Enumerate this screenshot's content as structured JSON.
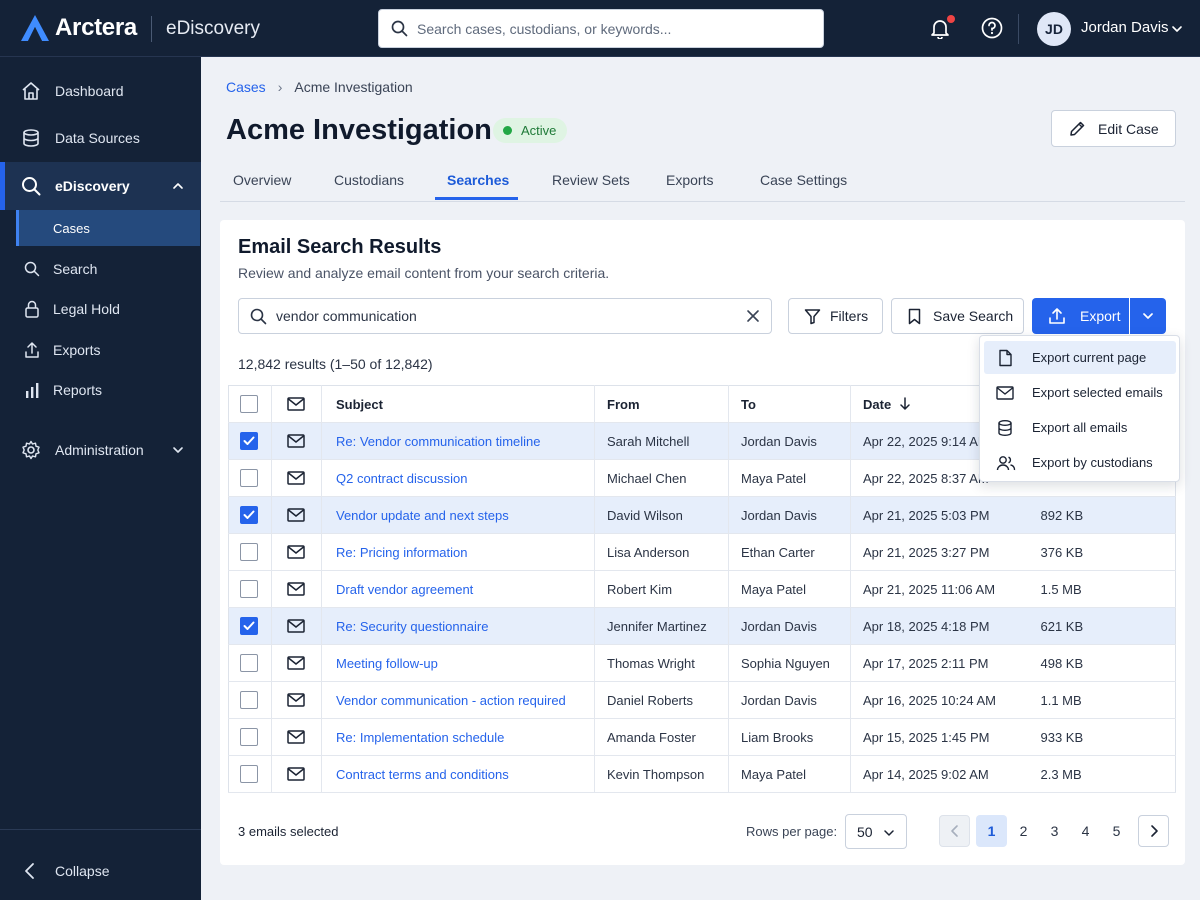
{
  "app": {
    "brand": "Arctera",
    "product": "eDiscovery",
    "search_placeholder": "Search cases, custodians, or keywords...",
    "user": {
      "initials": "JD",
      "name": "Jordan Davis"
    },
    "accent": "#2563eb"
  },
  "sidebar": {
    "items": [
      {
        "label": "Dashboard",
        "icon": "home-icon"
      },
      {
        "label": "Data Sources",
        "icon": "database-icon"
      },
      {
        "label": "eDiscovery",
        "icon": "search-icon"
      },
      {
        "label": "Cases"
      },
      {
        "label": "Search",
        "icon": "search-icon"
      },
      {
        "label": "Legal Hold",
        "icon": "lock-icon"
      },
      {
        "label": "Exports",
        "icon": "upload-icon"
      },
      {
        "label": "Reports",
        "icon": "bar-chart-icon"
      },
      {
        "label": "Administration",
        "icon": "gear-icon"
      }
    ],
    "collapse": "Collapse"
  },
  "breadcrumb": {
    "root": "Cases",
    "current": "Acme Investigation"
  },
  "case": {
    "title": "Acme Investigation",
    "status": "Active",
    "edit_label": "Edit Case"
  },
  "tabs": [
    "Overview",
    "Custodians",
    "Searches",
    "Review Sets",
    "Exports",
    "Case Settings"
  ],
  "active_tab": "Searches",
  "results": {
    "title": "Email Search Results",
    "subtitle": "Review and analyze email content from your search criteria.",
    "query": "vendor communication",
    "filters_label": "Filters",
    "save_label": "Save Search",
    "export_label": "Export",
    "count_text": "12,842 results (1–50 of 12,842)",
    "columns": {
      "subject": "Subject",
      "from": "From",
      "to": "To",
      "date": "Date"
    },
    "rows": [
      {
        "checked": true,
        "subject": "Re: Vendor communication timeline",
        "from": "Sarah Mitchell",
        "to": "Jordan Davis",
        "date": "Apr 22, 2025 9:14 AM",
        "size": ""
      },
      {
        "checked": false,
        "subject": "Q2 contract discussion",
        "from": "Michael Chen",
        "to": "Maya Patel",
        "date": "Apr 22, 2025 8:37 AM",
        "size": ""
      },
      {
        "checked": true,
        "subject": "Vendor update and next steps",
        "from": "David Wilson",
        "to": "Jordan Davis",
        "date": "Apr 21, 2025 5:03 PM",
        "size": "892 KB"
      },
      {
        "checked": false,
        "subject": "Re: Pricing information",
        "from": "Lisa Anderson",
        "to": "Ethan Carter",
        "date": "Apr 21, 2025 3:27 PM",
        "size": "376 KB"
      },
      {
        "checked": false,
        "subject": "Draft vendor agreement",
        "from": "Robert Kim",
        "to": "Maya Patel",
        "date": "Apr 21, 2025 11:06 AM",
        "size": "1.5 MB"
      },
      {
        "checked": true,
        "subject": "Re: Security questionnaire",
        "from": "Jennifer Martinez",
        "to": "Jordan Davis",
        "date": "Apr 18, 2025 4:18 PM",
        "size": "621 KB"
      },
      {
        "checked": false,
        "subject": "Meeting follow-up",
        "from": "Thomas Wright",
        "to": "Sophia Nguyen",
        "date": "Apr 17, 2025 2:11 PM",
        "size": "498 KB"
      },
      {
        "checked": false,
        "subject": "Vendor communication - action required",
        "from": "Daniel Roberts",
        "to": "Jordan Davis",
        "date": "Apr 16, 2025 10:24 AM",
        "size": "1.1 MB"
      },
      {
        "checked": false,
        "subject": "Re: Implementation schedule",
        "from": "Amanda Foster",
        "to": "Liam Brooks",
        "date": "Apr 15, 2025 1:45 PM",
        "size": "933 KB"
      },
      {
        "checked": false,
        "subject": "Contract terms and conditions",
        "from": "Kevin Thompson",
        "to": "Maya Patel",
        "date": "Apr 14, 2025 9:02 AM",
        "size": "2.3 MB"
      }
    ],
    "selected_text": "3 emails selected",
    "rows_per_page_label": "Rows per page:",
    "rows_per_page": "50",
    "pages": [
      "1",
      "2",
      "3",
      "4",
      "5"
    ],
    "current_page": "1"
  },
  "export_menu": [
    {
      "label": "Export current page",
      "icon": "file-icon"
    },
    {
      "label": "Export selected emails",
      "icon": "mail-icon"
    },
    {
      "label": "Export all emails",
      "icon": "database-icon"
    },
    {
      "label": "Export by custodians",
      "icon": "users-icon"
    }
  ]
}
